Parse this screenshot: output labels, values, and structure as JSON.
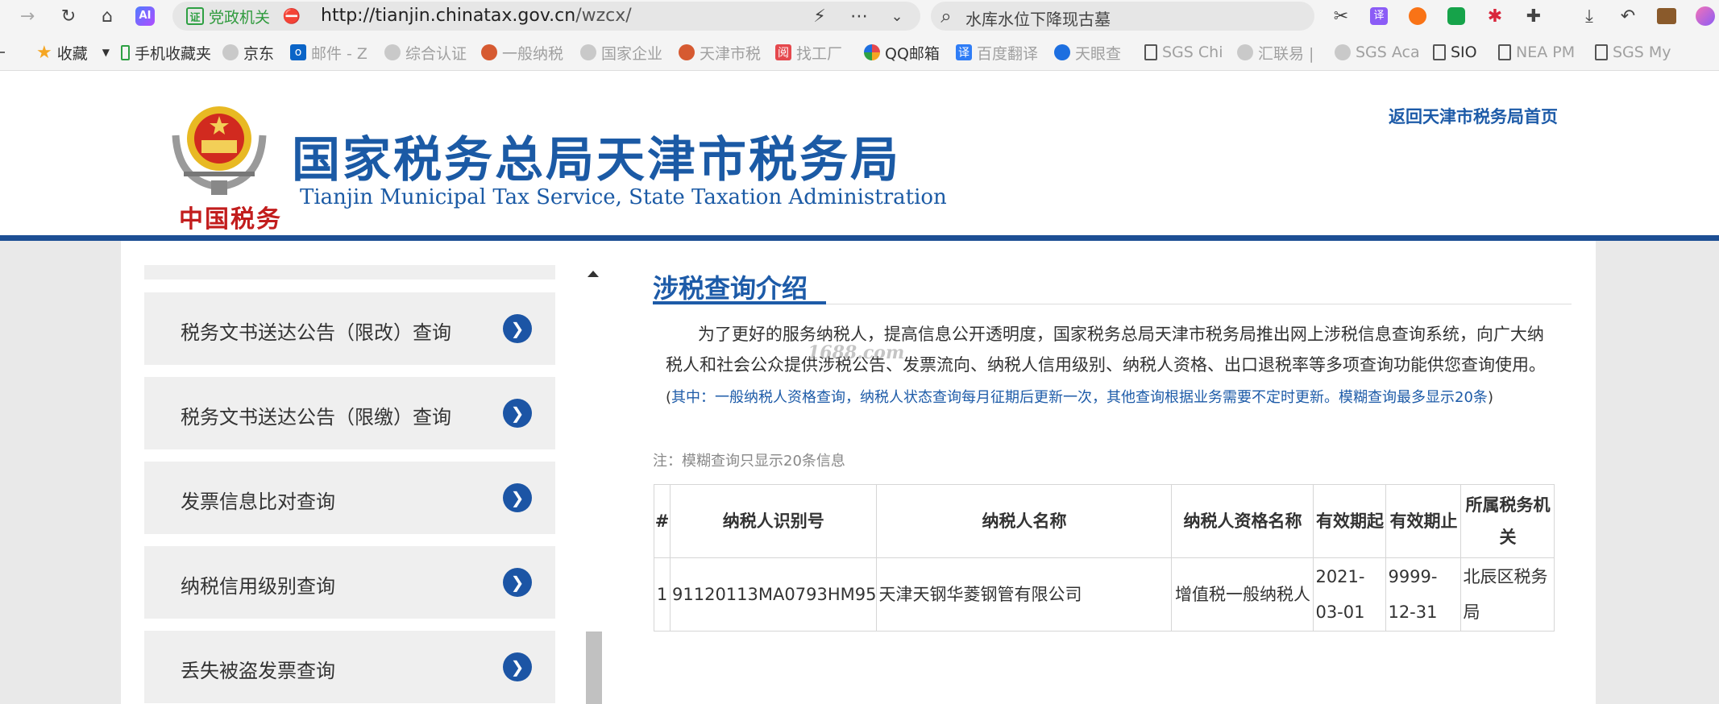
{
  "browser": {
    "site_badge": "党政机关",
    "site_badge_icon": "证",
    "url_host": "http://tianjin.chinatax.gov.cn",
    "url_path": "/wzcx/",
    "search_text": "水库水位下降现古墓"
  },
  "bookmarks": [
    {
      "label": "收藏",
      "icon": "star-icon"
    },
    {
      "label": "手机收藏夹",
      "icon": "phone-icon"
    },
    {
      "label": "京东",
      "icon": "globe-icon"
    },
    {
      "label": "邮件 - Z",
      "icon": "mail-icon"
    },
    {
      "label": "综合认证",
      "icon": "globe-icon"
    },
    {
      "label": "一般纳税",
      "icon": "emblem-icon"
    },
    {
      "label": "国家企业",
      "icon": "globe-icon"
    },
    {
      "label": "天津市税",
      "icon": "emblem-icon"
    },
    {
      "label": "找工厂",
      "icon": "factory-icon"
    },
    {
      "label": "QQ邮箱",
      "icon": "qq-mail-icon"
    },
    {
      "label": "百度翻译",
      "icon": "translate-icon"
    },
    {
      "label": "天眼查",
      "icon": "tianyancha-icon"
    },
    {
      "label": "SGS Chi",
      "icon": "page-icon"
    },
    {
      "label": "汇联易 |",
      "icon": "globe-icon"
    },
    {
      "label": "SGS Aca",
      "icon": "globe-icon"
    },
    {
      "label": "SIO",
      "icon": "page-icon"
    },
    {
      "label": "NEA PM",
      "icon": "page-icon"
    },
    {
      "label": "SGS My",
      "icon": "page-icon"
    }
  ],
  "header": {
    "title_cn": "国家税务总局天津市税务局",
    "title_en": "Tianjin Municipal Tax Service, State Taxation Administration",
    "emblem_caption": "中国税务",
    "home_link": "返回天津市税务局首页"
  },
  "sidebar": {
    "items": [
      {
        "label": "税务文书送达公告（限改）查询"
      },
      {
        "label": "税务文书送达公告（限缴）查询"
      },
      {
        "label": "发票信息比对查询"
      },
      {
        "label": "纳税信用级别查询"
      },
      {
        "label": "丢失被盗发票查询"
      }
    ]
  },
  "content": {
    "title": "涉税查询介绍",
    "intro": "为了更好的服务纳税人，提高信息公开透明度，国家税务总局天津市税务局推出网上涉税信息查询系统，向广大纳税人和社会公众提供涉税公告、发票流向、纳税人信用级别、纳税人资格、出口退税率等多项查询功能供您查询使用。",
    "note_open": "(",
    "note_blue": "其中：一般纳税人资格查询，纳税人状态查询每月征期后更新一次，其他查询根据业务需要不定时更新。模糊查询最多显示20条",
    "note_close": ")",
    "watermark": "1688.com",
    "fuzzy_note": "注：模糊查询只显示20条信息"
  },
  "table": {
    "headers": [
      "#",
      "纳税人识别号",
      "纳税人名称",
      "纳税人资格名称",
      "有效期起",
      "有效期止",
      "所属税务机关"
    ],
    "rows": [
      [
        "1",
        "91120113MA0793HM95",
        "天津天钢华菱钢管有限公司",
        "增值税一般纳税人",
        "2021-03-01",
        "9999-12-31",
        "北辰区税务局"
      ]
    ]
  },
  "colors": {
    "brand_blue": "#1d5ba8",
    "header_rule": "#1d4f94",
    "emblem_red": "#c21d1d"
  }
}
